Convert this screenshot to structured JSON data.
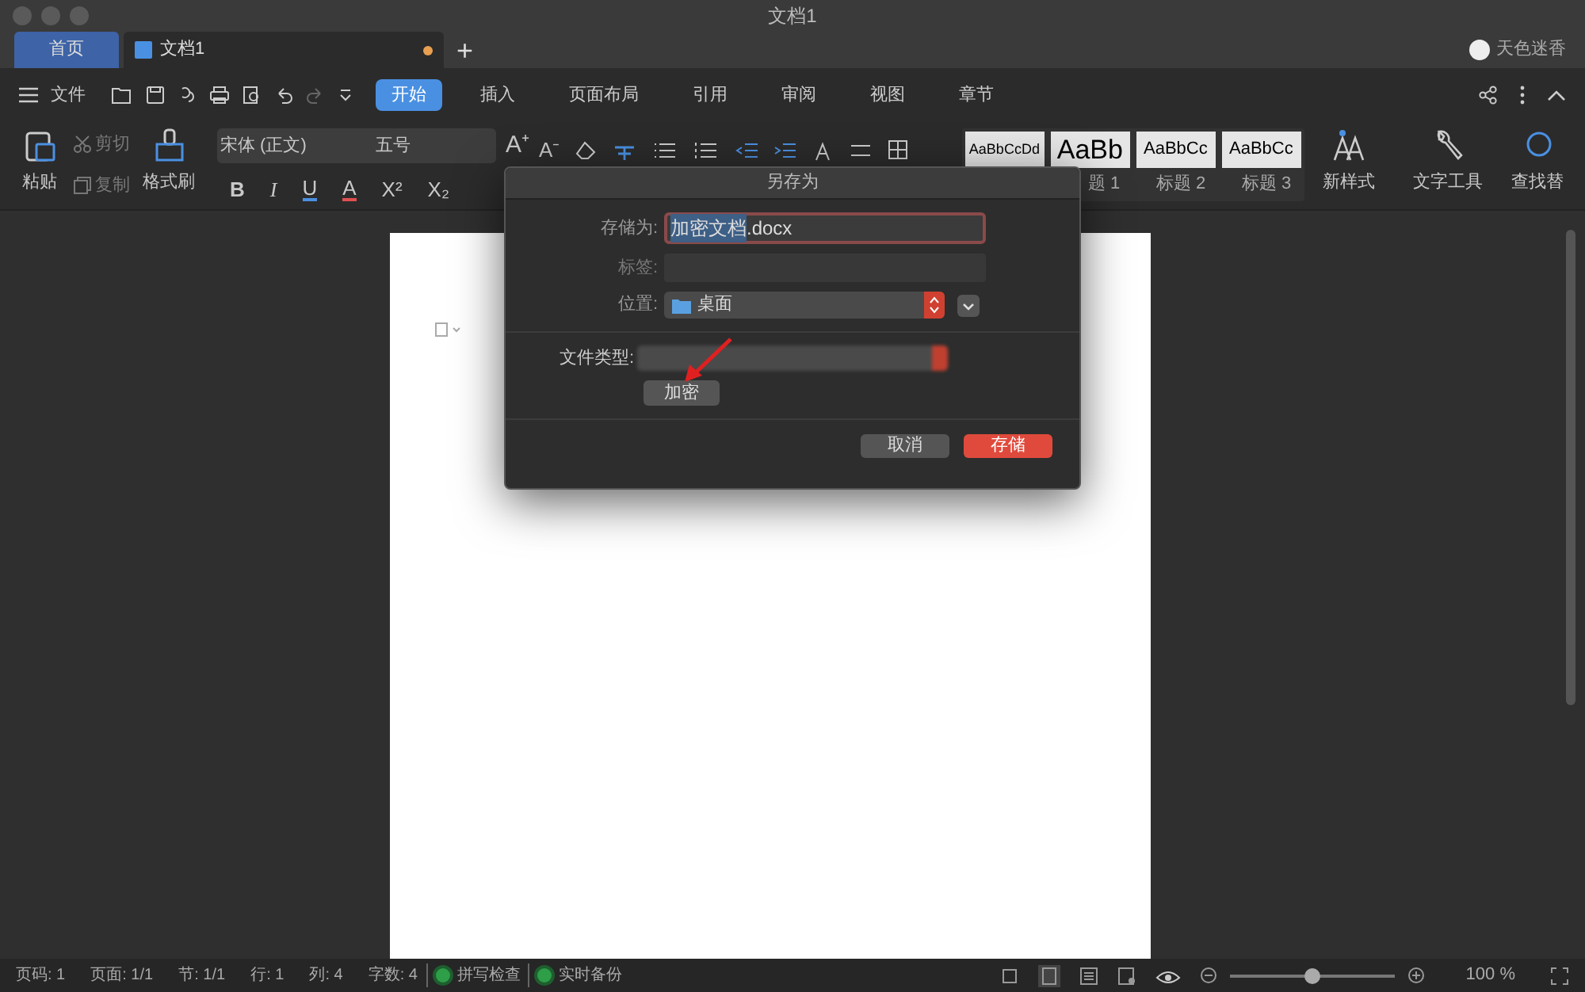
{
  "window": {
    "title": "文档1"
  },
  "tabs": [
    {
      "label": "首页",
      "kind": "home",
      "selected": true,
      "modified": false
    },
    {
      "label": "文档1",
      "kind": "doc",
      "selected": false,
      "modified": true
    }
  ],
  "new_tab": "+",
  "user": {
    "name": "天色迷香"
  },
  "menu": {
    "file": "文件",
    "tabs": [
      {
        "label": "开始",
        "selected": true
      },
      {
        "label": "插入",
        "selected": false
      },
      {
        "label": "页面布局",
        "selected": false
      },
      {
        "label": "引用",
        "selected": false
      },
      {
        "label": "审阅",
        "selected": false
      },
      {
        "label": "视图",
        "selected": false
      },
      {
        "label": "章节",
        "selected": false
      }
    ]
  },
  "ribbon": {
    "paste": "粘贴",
    "cut": "剪切",
    "copy": "复制",
    "format_painter": "格式刷",
    "font": "宋体 (正文)",
    "size": "五号",
    "grow_font": "A⁺",
    "shrink_font": "A⁻",
    "format_buttons": [
      {
        "kind": "bold",
        "label": "B"
      },
      {
        "kind": "italic",
        "label": "I"
      },
      {
        "kind": "underline",
        "label": "U"
      },
      {
        "kind": "color",
        "label": "A"
      },
      {
        "kind": "superscript",
        "label": "X²"
      },
      {
        "kind": "subscript",
        "label": "X₂"
      }
    ],
    "styles": [
      {
        "sample": "AaBbCcDd"
      },
      {
        "sample": "AaBb",
        "label": "题 1"
      },
      {
        "sample": "AaBbCc",
        "label": "标题 2"
      },
      {
        "sample": "AaBbCc",
        "label": "标题 3"
      }
    ],
    "new_style": "新样式",
    "text_tools": "文字工具",
    "find": "查找替"
  },
  "dialog": {
    "title": "另存为",
    "save_as_label": "存储为:",
    "file_name_selected": "加密文档",
    "file_name_rest": ".docx",
    "tags_label": "标签:",
    "location_label": "位置:",
    "location": "桌面",
    "file_type_label": "文件类型:",
    "encrypt": "加密",
    "cancel": "取消",
    "save": "存储"
  },
  "status_bar": {
    "items": [
      "页码: 1",
      "页面: 1/1",
      "节: 1/1",
      "行: 1",
      "列: 4",
      "字数: 4"
    ],
    "toggles": [
      {
        "label": "拼写检查",
        "on": true
      },
      {
        "label": "实时备份",
        "on": true
      }
    ],
    "zoom": {
      "level": 0.5,
      "reading": "100 %"
    }
  }
}
